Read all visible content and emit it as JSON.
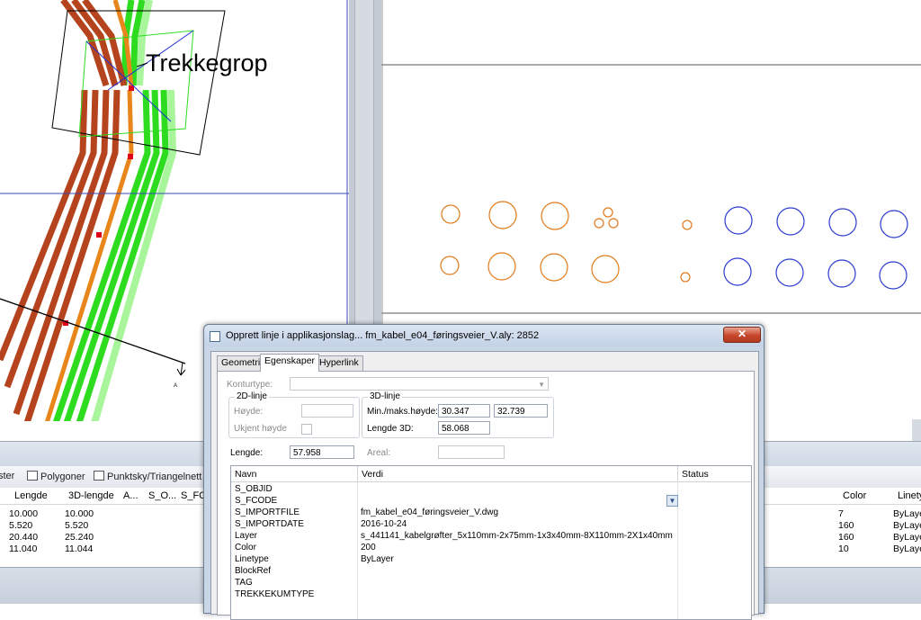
{
  "canvas_left": {
    "label_text": "Trekkegrop"
  },
  "bottom_panel": {
    "tabs": [
      {
        "label": "ster",
        "icon": "layer-icon"
      },
      {
        "label": "Polygoner",
        "icon": "polygon-icon"
      },
      {
        "label": "Punktsky/Triangelnett",
        "icon": "pointcloud-icon"
      }
    ],
    "columns_left": [
      "Lengde",
      "3D-lengde",
      "A...",
      "S_O...",
      "S_FC"
    ],
    "columns_right": [
      "Color",
      "Linety"
    ],
    "rows": [
      {
        "lengde": "10.000",
        "lengde3d": "10.000",
        "color": "7",
        "linetype": "ByLaye"
      },
      {
        "lengde": "5.520",
        "lengde3d": "5.520",
        "color": "160",
        "linetype": "ByLaye"
      },
      {
        "lengde": "20.440",
        "lengde3d": "25.240",
        "color": "160",
        "linetype": "ByLaye"
      },
      {
        "lengde": "11.040",
        "lengde3d": "11.044",
        "color": "10",
        "linetype": "ByLaye"
      }
    ]
  },
  "dialog": {
    "title": "Opprett linje i applikasjonslag... fm_kabel_e04_føringsveier_V.aly: 2852",
    "close_label": "✕",
    "tabs": [
      "Geometri",
      "Egenskaper",
      "Hyperlink"
    ],
    "active_tab": "Egenskaper",
    "konturtype_label": "Konturtype:",
    "konturtype_value": "",
    "group_2d": {
      "title": "2D-linje",
      "hoyde_label": "Høyde:",
      "hoyde_value": "",
      "ukjent_label": "Ukjent høyde"
    },
    "group_3d": {
      "title": "3D-linje",
      "minmax_label": "Min./maks.høyde:",
      "min_value": "30.347",
      "max_value": "32.739",
      "lengde3d_label": "Lengde 3D:",
      "lengde3d_value": "58.068"
    },
    "lengde_label": "Lengde:",
    "lengde_value": "57.958",
    "areal_label": "Areal:",
    "areal_value": "",
    "grid": {
      "headers": [
        "Navn",
        "Verdi",
        "Status"
      ],
      "rows": [
        {
          "name": "S_OBJID",
          "value": ""
        },
        {
          "name": "S_FCODE",
          "value": ""
        },
        {
          "name": "S_IMPORTFILE",
          "value": "fm_kabel_e04_føringsveier_V.dwg"
        },
        {
          "name": "S_IMPORTDATE",
          "value": "2016-10-24"
        },
        {
          "name": "Layer",
          "value": "s_441141_kabelgrøfter_5x110mm-2x75mm-1x3x40mm-8X110mm-2X1x40mm"
        },
        {
          "name": "Color",
          "value": "200"
        },
        {
          "name": "Linetype",
          "value": "ByLayer"
        },
        {
          "name": "BlockRef",
          "value": ""
        },
        {
          "name": "TAG",
          "value": ""
        },
        {
          "name": "TREKKEKUMTYPE",
          "value": ""
        }
      ]
    }
  },
  "colors": {
    "brown": "#b5441e",
    "orange": "#e8861c",
    "green": "#2ddc1f",
    "light_green": "#a8f59c",
    "blue_circle": "#2d3ccf",
    "orange_circle": "#e07b1a",
    "crosshair": "#3848b8"
  }
}
